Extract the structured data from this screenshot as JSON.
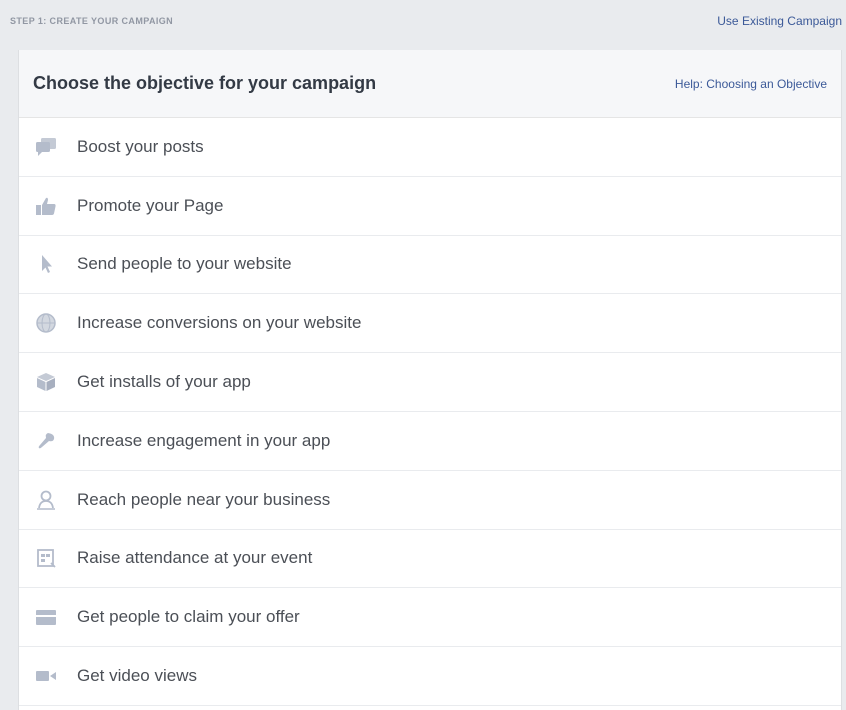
{
  "header": {
    "step_label": "STEP 1: CREATE YOUR CAMPAIGN",
    "use_existing_label": "Use Existing Campaign"
  },
  "panel": {
    "title": "Choose the objective for your campaign",
    "help_label": "Help: Choosing an Objective"
  },
  "objectives": [
    {
      "label": "Boost your posts",
      "icon": "speech-bubbles-icon"
    },
    {
      "label": "Promote your Page",
      "icon": "thumbs-up-icon"
    },
    {
      "label": "Send people to your website",
      "icon": "cursor-icon"
    },
    {
      "label": "Increase conversions on your website",
      "icon": "globe-icon"
    },
    {
      "label": "Get installs of your app",
      "icon": "box-icon"
    },
    {
      "label": "Increase engagement in your app",
      "icon": "paint-brush-icon"
    },
    {
      "label": "Reach people near your business",
      "icon": "person-location-icon"
    },
    {
      "label": "Raise attendance at your event",
      "icon": "calendar-icon"
    },
    {
      "label": "Get people to claim your offer",
      "icon": "offer-tag-icon"
    },
    {
      "label": "Get video views",
      "icon": "video-camera-icon"
    }
  ],
  "colors": {
    "link": "#3b5998",
    "icon": "#b4bccb",
    "text": "#4b4f56"
  }
}
